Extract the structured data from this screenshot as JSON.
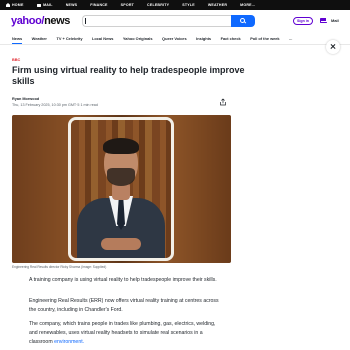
{
  "topnav": {
    "items": [
      "HOME",
      "MAIL",
      "NEWS",
      "FINANCE",
      "SPORT",
      "CELEBRITY",
      "STYLE",
      "WEATHER",
      "MORE..."
    ]
  },
  "header": {
    "logo_yahoo": "yahoo",
    "logo_slash": "/",
    "logo_news": "news",
    "search_value": "",
    "search_icon": "search-icon",
    "signin_label": "Sign in",
    "mail_label": "Mail",
    "accent_color": "#6001d2",
    "search_button_color": "#0f69ff"
  },
  "subnav": {
    "items": [
      "News",
      "Weather",
      "TV + Celebrity",
      "Local News",
      "Yahoo Originals",
      "Queer Voices",
      "Insights",
      "Fact check",
      "Poll of the week",
      "..."
    ],
    "active_index": 0
  },
  "article": {
    "badge": "BBC",
    "badge_color": "#e0242c",
    "title": "Firm using virtual reality to help tradespeople improve skills",
    "author": "Ryan Morwood",
    "meta": "Thu, 13 February 2025, 10:30 pm GMT·5      1 min read",
    "share_icon": "share-icon",
    "caption": "Engineering Real Results director Ricky Sharma (Image: Supplied)",
    "paragraphs": {
      "p1": "A training company is using virtual reality to help tradespeople improve their skills.",
      "p2": "Engineering Real Results (ERR) now offers virtual reality training at centres across the country, including in Chandler's Ford.",
      "p3_text": "The company, which trains people in trades like plumbing, gas, electrics, welding, and renewables, uses virtual reality headsets to simulate real scenarios in a classroom ",
      "p3_link": "environment."
    }
  },
  "close_icon": "close-icon"
}
